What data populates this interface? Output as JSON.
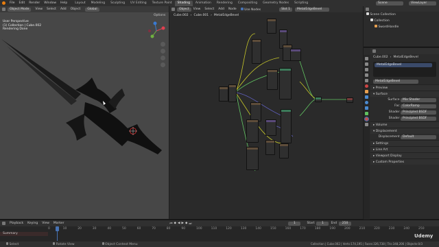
{
  "top_menu": {
    "items": [
      "File",
      "Edit",
      "Render",
      "Window",
      "Help"
    ],
    "tabs": [
      "Layout",
      "Modeling",
      "Sculpting",
      "UV Editing",
      "Texture Paint",
      "Shading",
      "Animation",
      "Rendering",
      "Compositing",
      "Geometry Nodes",
      "Scripting"
    ],
    "active_tab": "Shading",
    "scene": "Scene",
    "view_layer": "ViewLayer"
  },
  "viewport": {
    "mode": "Object Mode",
    "menus": [
      "View",
      "Select",
      "Add",
      "Object"
    ],
    "orientation": "Global",
    "options": "Options",
    "info_lines": [
      "User Perspective",
      "(1) Collection | Cube.002",
      "Rendering Done"
    ]
  },
  "node_editor": {
    "object_label": "Object",
    "menus": [
      "View",
      "Select",
      "Add",
      "Node"
    ],
    "use_nodes": "Use Nodes",
    "slot": "Slot 1",
    "material": "MetalEdgeBevel",
    "breadcrumb": [
      "Cube.002",
      "Cube.001",
      "MetalEdgeBevel"
    ]
  },
  "outliner": {
    "title": "Scene Collection",
    "items": [
      "Collection",
      "SwordHandle"
    ]
  },
  "properties": {
    "object": "Cube.002",
    "material": "MetalEdgeBevel",
    "slot_material": "MetalEdgeBevel",
    "material_field": "MetalEdgeBevel",
    "sections": {
      "preview": "Preview",
      "surface": "Surface",
      "volume": "Volume",
      "displacement": "Displacement",
      "settings": "Settings",
      "line_art": "Line Art",
      "viewport_display": "Viewport Display",
      "custom_properties": "Custom Properties"
    },
    "rows": [
      {
        "label": "Surface",
        "value": "Mix Shader"
      },
      {
        "label": "Fac",
        "value": "ColorRamp"
      },
      {
        "label": "Shader",
        "value": "Principled BSDF"
      },
      {
        "label": "Shader",
        "value": "Principled BSDF"
      }
    ],
    "displacement_row": {
      "label": "Displacement",
      "value": "Default"
    }
  },
  "timeline": {
    "menus": [
      "Playback",
      "Keying",
      "View",
      "Marker"
    ],
    "current_frame": "1",
    "start_label": "Start",
    "start": "1",
    "end_label": "End",
    "end": "250",
    "ticks": [
      "0",
      "10",
      "20",
      "30",
      "40",
      "50",
      "60",
      "70",
      "80",
      "90",
      "100",
      "110",
      "120",
      "130",
      "140",
      "150",
      "160",
      "170",
      "180",
      "190",
      "200",
      "210",
      "220",
      "230",
      "240",
      "250"
    ],
    "summary": "Summary"
  },
  "status_bar": {
    "select": "Select",
    "rotate": "Rotate View",
    "context": "Object Context Menu",
    "stats": "Collection | Cube.002 | Verts:174,195 | Faces:326,738 | Tris:348,206 | Objects:0/3"
  },
  "watermark": "Udemy",
  "colors": {
    "accent": "#4772b3",
    "active_tab": "#4d4d4d",
    "node_wire_yellow": "#c7c729",
    "node_wire_green": "#63c763",
    "node_wire_purple": "#6363c7"
  }
}
